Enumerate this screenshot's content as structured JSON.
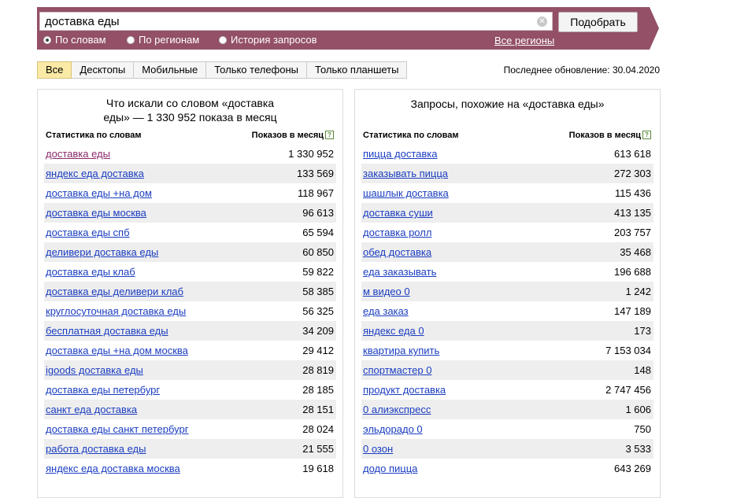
{
  "search": {
    "query": "доставка еды",
    "button_label": "Подобрать",
    "modes": [
      {
        "label": "По словам",
        "selected": true
      },
      {
        "label": "По регионам",
        "selected": false
      },
      {
        "label": "История запросов",
        "selected": false
      }
    ],
    "regions_link": "Все регионы"
  },
  "tabs": [
    "Все",
    "Десктопы",
    "Мобильные",
    "Только телефоны",
    "Только планшеты"
  ],
  "active_tab": "Все",
  "last_update": "Последнее обновление: 30.04.2020",
  "left_panel": {
    "title_line1": "Что искали со словом «доставка",
    "title_line2": "еды» — 1 330 952 показа в месяц",
    "col_keyword": "Статистика по словам",
    "col_shows": "Показов в месяц",
    "help": "?",
    "rows": [
      {
        "kw": "доставка еды",
        "n": "1 330 952"
      },
      {
        "kw": "яндекс еда доставка",
        "n": "133 569"
      },
      {
        "kw": "доставка еды +на дом",
        "n": "118 967"
      },
      {
        "kw": "доставка еды москва",
        "n": "96 613"
      },
      {
        "kw": "доставка еды спб",
        "n": "65 594"
      },
      {
        "kw": "деливери доставка еды",
        "n": "60 850"
      },
      {
        "kw": "доставка еды клаб",
        "n": "59 822"
      },
      {
        "kw": "доставка еды деливери клаб",
        "n": "58 385"
      },
      {
        "kw": "круглосуточная доставка еды",
        "n": "56 325"
      },
      {
        "kw": "бесплатная доставка еды",
        "n": "34 209"
      },
      {
        "kw": "доставка еды +на дом москва",
        "n": "29 412"
      },
      {
        "kw": "igoods доставка еды",
        "n": "28 819"
      },
      {
        "kw": "доставка еды петербург",
        "n": "28 185"
      },
      {
        "kw": "санкт еда доставка",
        "n": "28 151"
      },
      {
        "kw": "доставка еды санкт петербург",
        "n": "28 024"
      },
      {
        "kw": "работа доставка еды",
        "n": "21 555"
      },
      {
        "kw": "яндекс еда доставка москва",
        "n": "19 618"
      }
    ]
  },
  "right_panel": {
    "title": "Запросы, похожие на «доставка еды»",
    "col_keyword": "Статистика по словам",
    "col_shows": "Показов в месяц",
    "help": "?",
    "rows": [
      {
        "kw": "пицца доставка",
        "n": "613 618"
      },
      {
        "kw": "заказывать пицца",
        "n": "272 303"
      },
      {
        "kw": "шашлык доставка",
        "n": "115 436"
      },
      {
        "kw": "доставка суши",
        "n": "413 135"
      },
      {
        "kw": "доставка ролл",
        "n": "203 757"
      },
      {
        "kw": "обед доставка",
        "n": "35 468"
      },
      {
        "kw": "еда заказывать",
        "n": "196 688"
      },
      {
        "kw": "м видео 0",
        "n": "1 242"
      },
      {
        "kw": "еда заказ",
        "n": "147 189"
      },
      {
        "kw": "яндекс еда 0",
        "n": "173"
      },
      {
        "kw": "квартира купить",
        "n": "7 153 034"
      },
      {
        "kw": "спортмастер 0",
        "n": "148"
      },
      {
        "kw": "продукт доставка",
        "n": "2 747 456"
      },
      {
        "kw": "0 алиэкспресс",
        "n": "1 606"
      },
      {
        "kw": "эльдорадо 0",
        "n": "750"
      },
      {
        "kw": "0 озон",
        "n": "3 533"
      },
      {
        "kw": "додо пицца",
        "n": "643 269"
      }
    ]
  },
  "colors": {
    "band": "#935067",
    "link": "#1a3dc1",
    "visited_link": "#8a2a6a",
    "active_tab": "#fbe9a6",
    "row_shade": "#eeeeee"
  }
}
